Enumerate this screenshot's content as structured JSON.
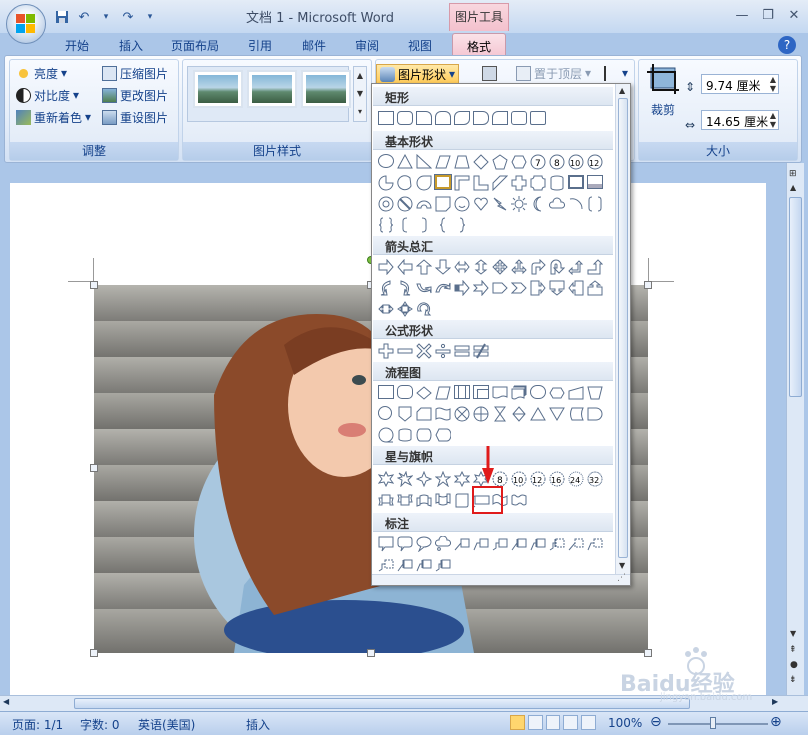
{
  "titlebar": {
    "title": "文档 1 - Microsoft Word",
    "tool_context": "图片工具"
  },
  "tabs": [
    {
      "label": "开始"
    },
    {
      "label": "插入"
    },
    {
      "label": "页面布局"
    },
    {
      "label": "引用"
    },
    {
      "label": "邮件"
    },
    {
      "label": "审阅"
    },
    {
      "label": "视图"
    },
    {
      "label": "格式"
    }
  ],
  "ribbon": {
    "adjust": {
      "label": "调整",
      "items": [
        "亮度",
        "对比度",
        "重新着色",
        "压缩图片",
        "更改图片",
        "重设图片"
      ]
    },
    "picture_styles": {
      "label": "图片样式"
    },
    "shape_button": "图片形状",
    "bring_front": "置于顶层",
    "size": {
      "label": "大小",
      "crop": "裁剪",
      "height": "9.74 厘米",
      "width": "14.65 厘米"
    }
  },
  "dropdown": {
    "sections": [
      "矩形",
      "基本形状",
      "箭头总汇",
      "公式形状",
      "流程图",
      "星与旗帜",
      "标注"
    ]
  },
  "statusbar": {
    "page": "页面: 1/1",
    "words": "字数: 0",
    "language": "英语(美国)",
    "mode": "插入",
    "zoom": "100%"
  },
  "watermark": {
    "brand": "Baidu经验",
    "url": "jingyan.baidu.com"
  }
}
